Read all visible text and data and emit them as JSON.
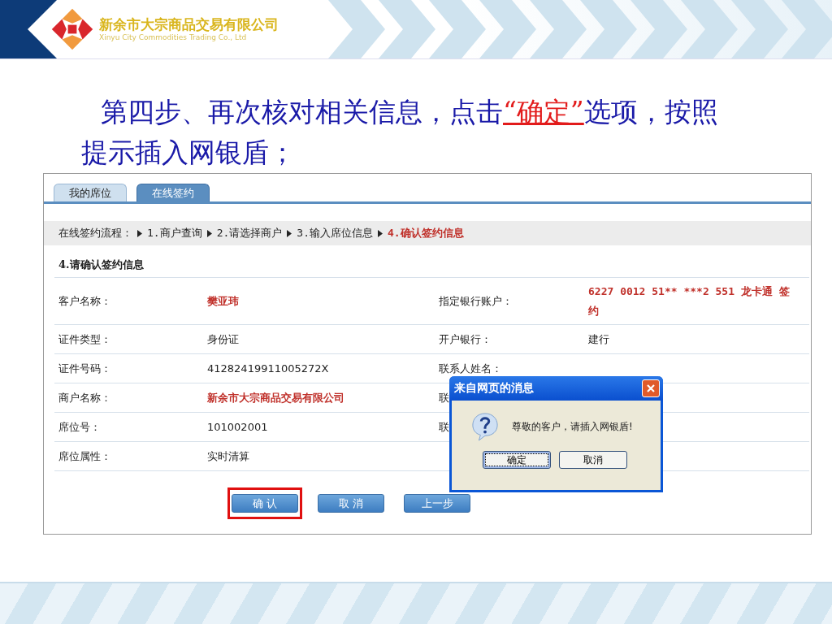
{
  "header": {
    "company_name": "新余市大宗商品交易有限公司",
    "company_name_en": "Xinyu City Commodities Trading Co., Ltd"
  },
  "title": [
    {
      "kind": "plain",
      "text": "第四步、再次核对相关信息，点击"
    },
    {
      "kind": "highlight",
      "text": "“确定”"
    },
    {
      "kind": "plain",
      "text": "选项，按照提示插入网银盾；"
    }
  ],
  "tabs": [
    {
      "label": "我的席位",
      "selected": false
    },
    {
      "label": "在线签约",
      "selected": true
    }
  ],
  "breadcrumb": {
    "label": "在线签约流程：",
    "steps": [
      {
        "label": "1.商户查询",
        "selected": false
      },
      {
        "label": "2.请选择商户",
        "selected": false
      },
      {
        "label": "3.输入席位信息",
        "selected": false
      },
      {
        "label": "4.确认签约信息",
        "selected": true
      }
    ]
  },
  "section_title": "4.请确认签约信息",
  "rows": [
    {
      "label": "客户名称：",
      "value": "樊亚玮",
      "emphasized": true,
      "label_2": "指定银行账户：",
      "value_2": "6227 0012 51** ***2 551 龙卡通 签约",
      "emphasized_2": true
    },
    {
      "label": "证件类型：",
      "value": "身份证",
      "emphasized": false,
      "label_2": "开户银行：",
      "value_2": "建行",
      "emphasized_2": false
    },
    {
      "label": "证件号码：",
      "value": "41282419911005272X",
      "emphasized": false,
      "label_2": "联系人姓名："
    },
    {
      "label": "商户名称：",
      "value": "新余市大宗商品交易有限公司",
      "emphasized": true,
      "label_2": "联"
    },
    {
      "label": "席位号：",
      "value": "101002001",
      "emphasized": false,
      "label_2": "联"
    },
    {
      "label": "席位属性：",
      "value": "实时清算",
      "emphasized": false
    }
  ],
  "buttons": [
    {
      "label": "确 认",
      "highlighted": true
    },
    {
      "label": "取 消",
      "highlighted": false
    },
    {
      "label": "上一步",
      "highlighted": false
    }
  ],
  "dialog": {
    "title": "来自网页的消息",
    "message": "尊敬的客户，请插入网银盾!",
    "buttons": [
      {
        "label": "确定",
        "focused": true
      },
      {
        "label": "取消",
        "focused": false
      }
    ]
  }
}
